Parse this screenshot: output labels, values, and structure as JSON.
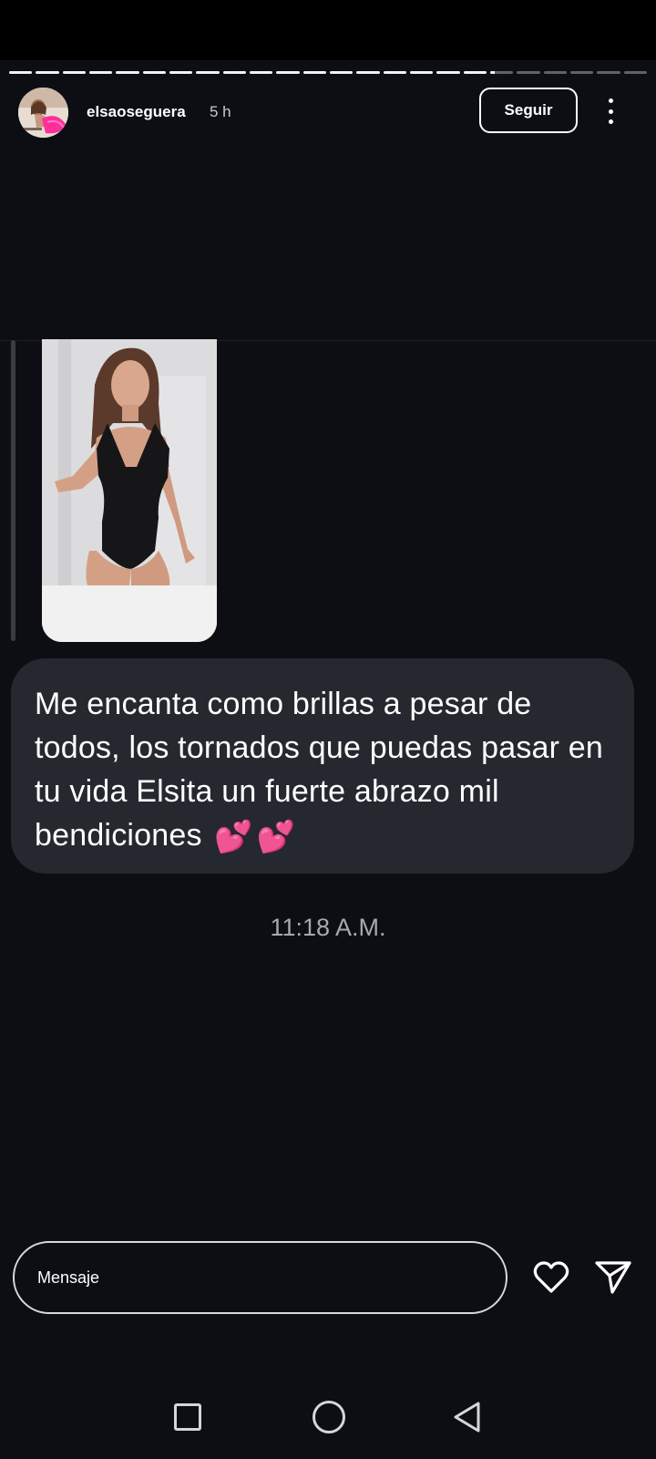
{
  "story": {
    "segments_total": 24,
    "segments_viewed": 18,
    "current_segment_progress": 0.2
  },
  "header": {
    "username": "elsaoseguera",
    "time_ago": "5 h",
    "follow_label": "Seguir",
    "more_icon": "more-vertical-icon"
  },
  "reply": {
    "story_thumbnail": "story-photo",
    "message_text": "Me encanta como brillas a pesar de todos, los tornados que puedas pasar en tu vida Elsita un fuerte abrazo mil bendiciones",
    "emojis": [
      "💕",
      "💕"
    ],
    "timestamp": "11:18 A.M."
  },
  "composer": {
    "placeholder": "Mensaje",
    "like_icon": "heart-icon",
    "send_icon": "send-icon"
  },
  "navbar": {
    "recents_icon": "square-icon",
    "home_icon": "circle-icon",
    "back_icon": "back-triangle-icon"
  },
  "colors": {
    "background": "#0c0e13",
    "bubble": "#25282f",
    "timestamp": "#a7a9ae",
    "pink_heart": "#ff3ea5"
  }
}
